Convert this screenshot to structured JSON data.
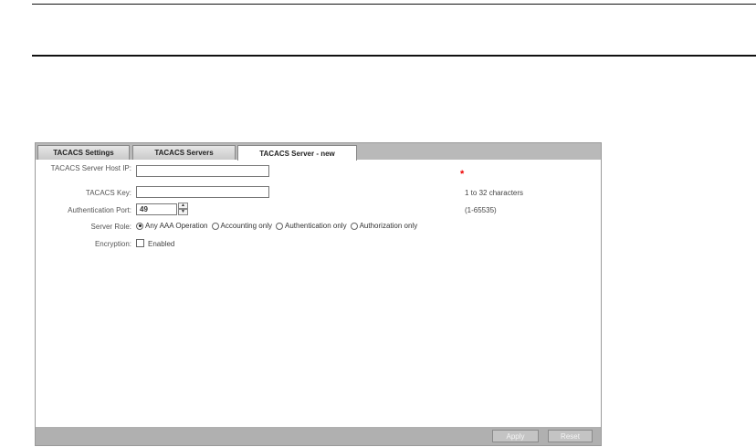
{
  "tabs": [
    {
      "label": "TACACS Settings"
    },
    {
      "label": "TACACS Servers"
    },
    {
      "label": "TACACS Server - new"
    }
  ],
  "form": {
    "host_label": "TACACS Server Host IP:",
    "host_value": "",
    "host_required_mark": "*",
    "key_label": "TACACS Key:",
    "key_value": "",
    "key_hint": "1 to 32 characters",
    "port_label": "Authentication Port:",
    "port_value": "49",
    "port_hint": "(1-65535)",
    "role_label": "Server Role:",
    "role_options": [
      {
        "label": "Any AAA Operation",
        "selected": true
      },
      {
        "label": "Accounting only",
        "selected": false
      },
      {
        "label": "Authentication only",
        "selected": false
      },
      {
        "label": "Authorization only",
        "selected": false
      }
    ],
    "encryption_label": "Encryption:",
    "encryption_option": "Enabled",
    "encryption_checked": false
  },
  "footer": {
    "apply_label": "Apply",
    "reset_label": "Reset"
  },
  "icons": {
    "spin_up": "up-arrow-icon",
    "spin_down": "down-arrow-icon"
  }
}
